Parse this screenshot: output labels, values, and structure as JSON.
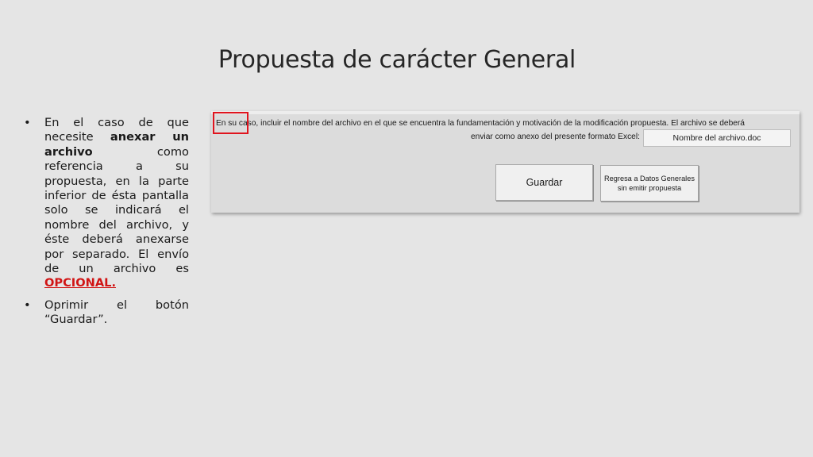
{
  "slide": {
    "title": "Propuesta de carácter General"
  },
  "bullets": {
    "b1_pre": "En el caso de que necesite ",
    "b1_bold": "anexar un archivo",
    "b1_mid": " como referencia a su propuesta, en la parte inferior de ésta pantalla solo se indicará el nombre del archivo, y éste deberá anexarse por separado. El envío de un archivo es ",
    "b1_red": "OPCIONAL.",
    "b2": "Oprimir el botón “Guardar”."
  },
  "form": {
    "instruction_highlight": "En su caso",
    "instruction_rest": ", incluir el nombre del archivo en el que se encuentra la fundamentación y motivación de la modificación propuesta. El archivo se deberá",
    "instruction_line2": "enviar como anexo del presente formato Excel:",
    "filename_value": "Nombre del archivo.doc",
    "save_label": "Guardar",
    "back_label": "Regresa a Datos Generales sin emitir propuesta"
  },
  "colors": {
    "highlight": "#e0141e",
    "opcional": "#d11414"
  }
}
